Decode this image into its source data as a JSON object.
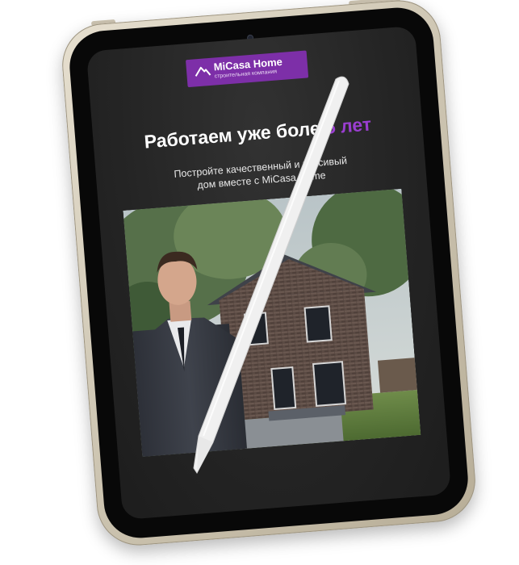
{
  "brand": {
    "name": "MiCasa Home",
    "tagline": "строительная компания",
    "color": "#7d2fa8"
  },
  "hero": {
    "headline_main": "Работаем уже боле",
    "headline_accent": "5 лет",
    "subline_1": "Постройте качественный и красивый",
    "subline_2": "дом вместе с MiCasa Home",
    "accent_color": "#9a3ed0"
  },
  "device": {
    "type": "tablet",
    "frame_color": "#d8d0bd",
    "screen_color": "#262626"
  },
  "photo": {
    "subject": "businessman-in-suit",
    "background": "two-story-brick-house"
  },
  "stylus": {
    "color": "#f4f4f4"
  }
}
